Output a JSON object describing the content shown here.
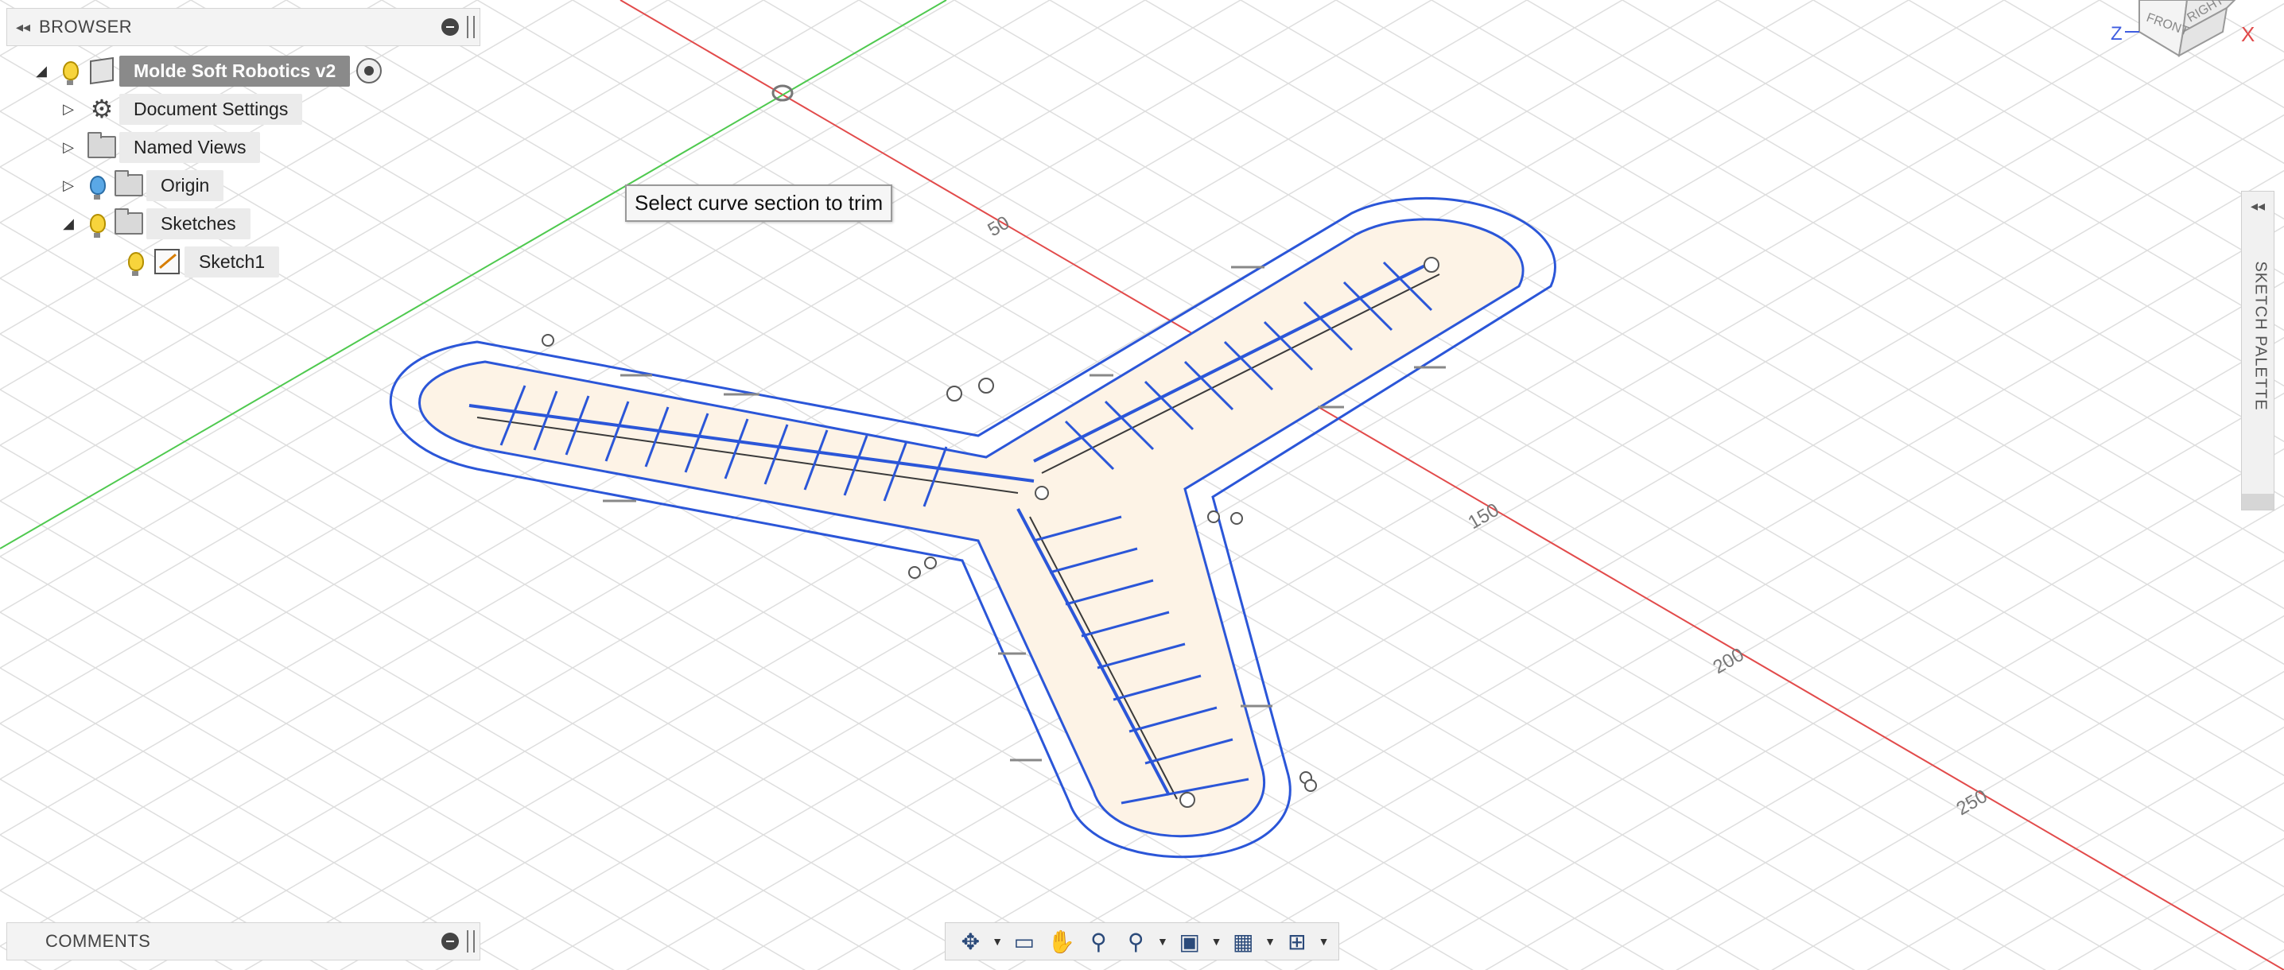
{
  "browser": {
    "title": "BROWSER",
    "items": [
      {
        "label": "Molde Soft Robotics v2"
      },
      {
        "label": "Document Settings"
      },
      {
        "label": "Named Views"
      },
      {
        "label": "Origin"
      },
      {
        "label": "Sketches"
      },
      {
        "label": "Sketch1"
      }
    ]
  },
  "tooltip": "Select curve section to trim",
  "comments": {
    "title": "COMMENTS"
  },
  "sketch_palette": {
    "title": "SKETCH PALETTE"
  },
  "viewcube": {
    "front": "FRONT",
    "right": "RIGHT",
    "z": "Z",
    "x": "X"
  },
  "grid_labels": [
    "50",
    "150",
    "200",
    "250"
  ],
  "colors": {
    "sketch_blue": "#2b56d8",
    "profile_fill": "#fdf3e6",
    "x_axis": "#e04a4a",
    "y_axis": "#4bc94b",
    "grid": "#dcdcdc"
  }
}
